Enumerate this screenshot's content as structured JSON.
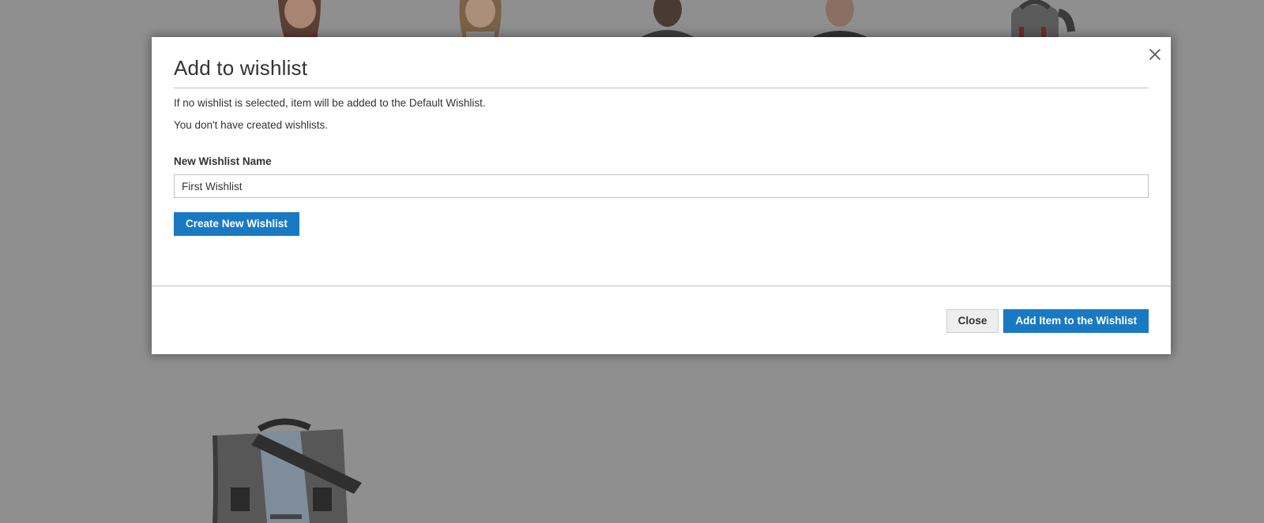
{
  "modal": {
    "title": "Add to wishlist",
    "close_icon": "close-icon",
    "info_default": "If no wishlist is selected, item will be added to the Default Wishlist.",
    "info_none": "You don't have created wishlists.",
    "new_name_label": "New Wishlist Name",
    "new_name_value": "First Wishlist",
    "create_button": "Create New Wishlist",
    "close_button": "Close",
    "add_button": "Add Item to the Wishlist"
  },
  "colors": {
    "primary": "#1979c3",
    "backdrop": "#8f8f8f"
  }
}
